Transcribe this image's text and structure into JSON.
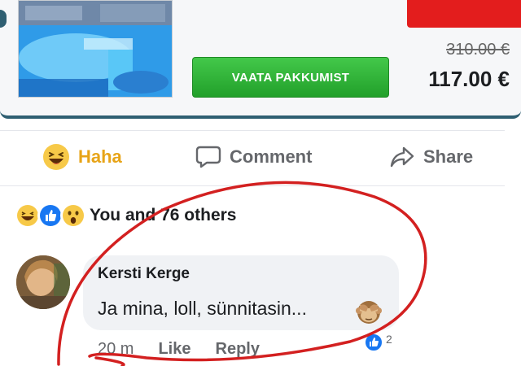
{
  "ad": {
    "cta_label": "VAATA PAKKUMIST",
    "old_price": "310.00 €",
    "new_price": "117.00 €"
  },
  "actions": {
    "haha_label": "Haha",
    "comment_label": "Comment",
    "share_label": "Share"
  },
  "reactions": {
    "icons": [
      "haha-emoji",
      "like",
      "wow-emoji"
    ],
    "summary_text": "You and 76 others"
  },
  "comment": {
    "author": "Kersti Kerge",
    "text": "Ja mina, loll, sünnitasin...",
    "emoji": "see-no-evil-monkey",
    "time": "20 m",
    "like_label": "Like",
    "reply_label": "Reply",
    "reaction_count": "2"
  },
  "colors": {
    "haha_accent": "#e7a418",
    "cta_green": "#2fb236",
    "annotation_red": "#d32020",
    "card_border": "#2f5f72"
  }
}
